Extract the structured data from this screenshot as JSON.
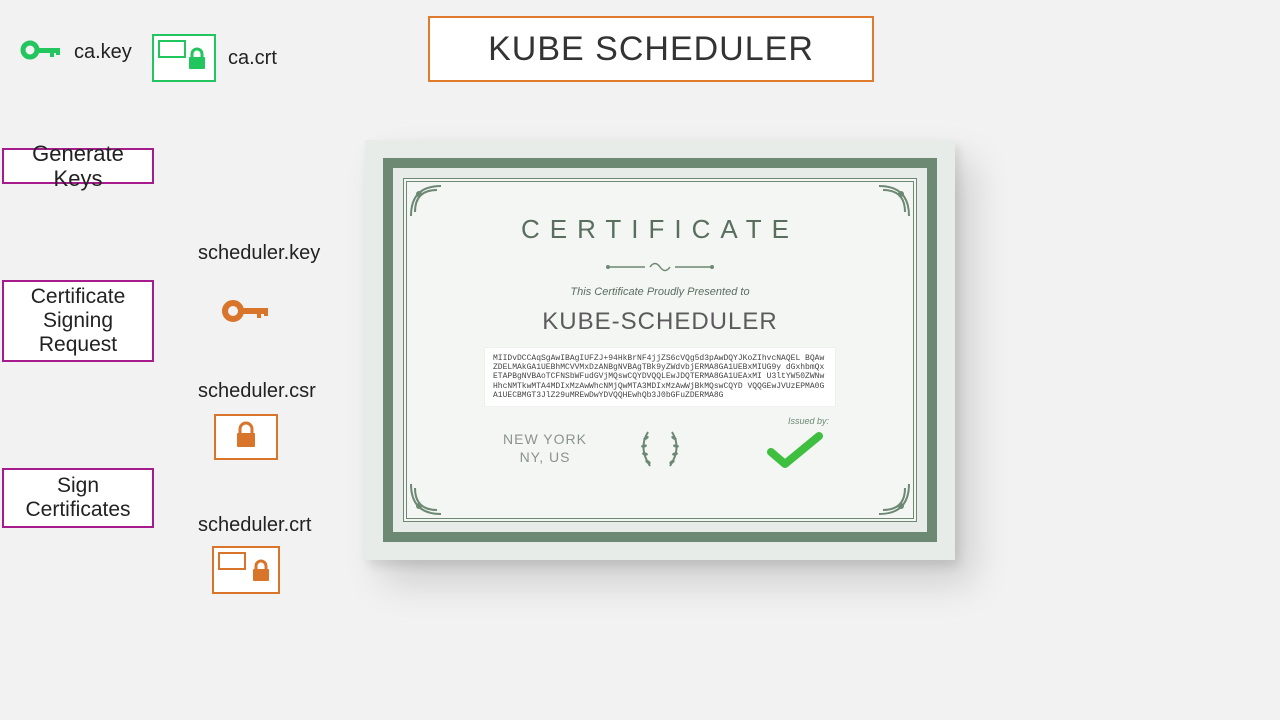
{
  "title": "KUBE SCHEDULER",
  "ca": {
    "key_label": "ca.key",
    "crt_label": "ca.crt"
  },
  "actions": {
    "generate_keys": "Generate Keys",
    "csr": "Certificate Signing Request",
    "sign": "Sign Certificates"
  },
  "artifacts": {
    "key_label": "scheduler.key",
    "csr_label": "scheduler.csr",
    "crt_label": "scheduler.crt"
  },
  "certificate": {
    "heading": "CERTIFICATE",
    "presented_to": "This Certificate Proudly Presented to",
    "name": "KUBE-SCHEDULER",
    "body": "MIIDvDCCAqSgAwIBAgIUFZJ+94HkBrNF4jjZS6cVQg5d3pAwDQYJKoZIhvcNAQEL\nBQAwZDELMAkGA1UEBhMCVVMxDzANBgNVBAgTBk9yZWdvbjERMA8GA1UEBxMIUG9y\ndGxhbmQxETAPBgNVBAoTCFNSbWFudGVjMQswCQYDVQQLEwJDQTERMA8GA1UEAxMI\nU3ltYW50ZWNwHhcNMTkwMTA4MDIxMzAwWhcNMjQwMTA3MDIxMzAwWjBkMQswCQYD\nVQQGEwJVUzEPMA0GA1UECBMGT3JlZ29uMREwDwYDVQQHEwhQb3J0bGFuZDERMA8G",
    "location_line1": "NEW YORK",
    "location_line2": "NY, US",
    "issued_by_label": "Issued by:"
  },
  "colors": {
    "title_border": "#e07b2e",
    "action_border": "#a61c8c",
    "green": "#22c55e",
    "orange": "#d9752a",
    "cert_frame": "#6d8973"
  }
}
